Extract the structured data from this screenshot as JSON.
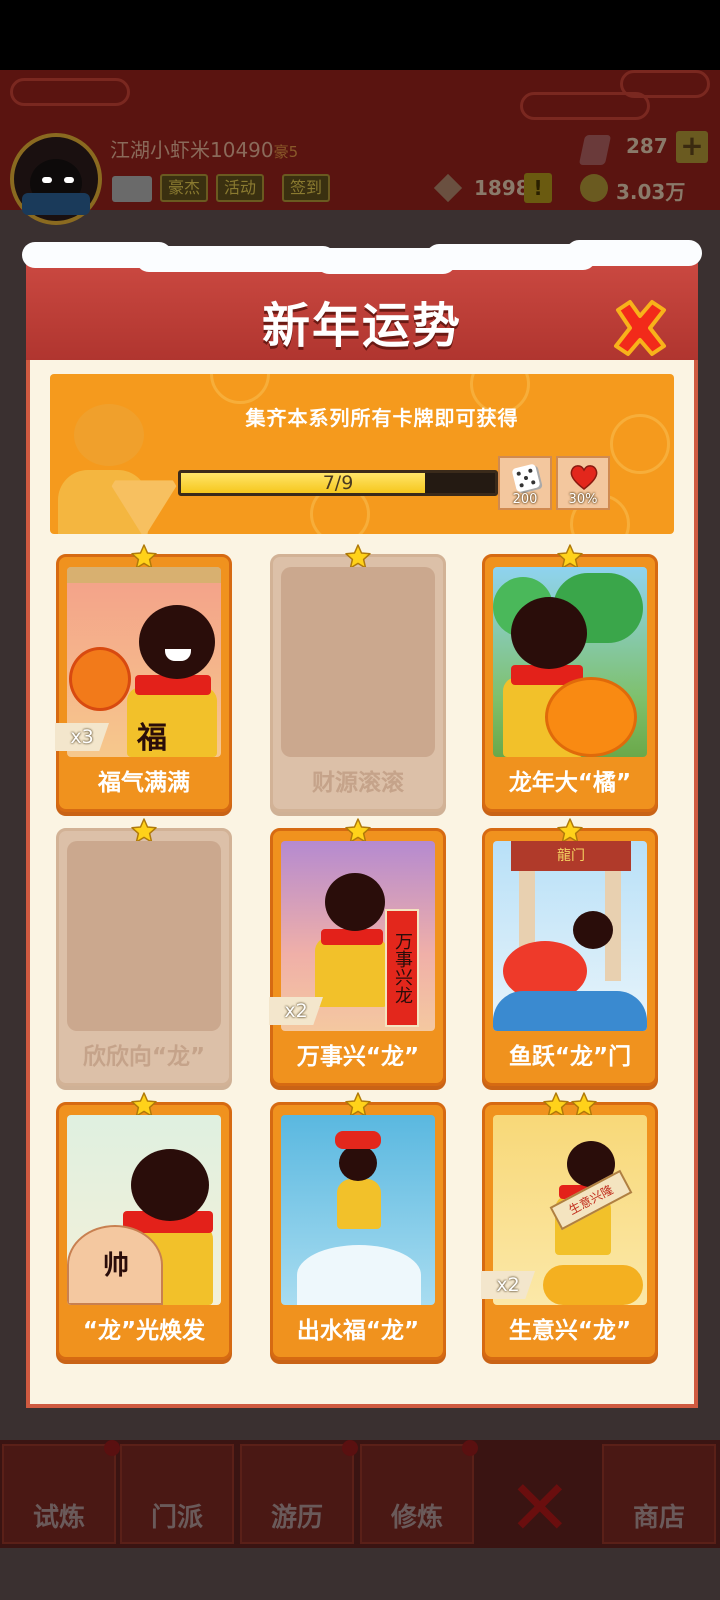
{
  "player": {
    "name": "江湖小虾米10490",
    "vip": "豪5",
    "buttons": [
      "豪杰",
      "活动",
      "签到"
    ],
    "gems": "287",
    "tokens": "1898",
    "coins": "3.03万"
  },
  "dialog": {
    "title": "新年运势",
    "reward_desc": "集齐本系列所有卡牌即可获得",
    "progress": {
      "label": "7/9",
      "collected": 7,
      "total": 9
    },
    "rewards": [
      {
        "icon": "dice-icon",
        "qty": "200"
      },
      {
        "icon": "heart-icon",
        "qty": "30%"
      }
    ],
    "cards": [
      {
        "name": "福气满满",
        "stars": 1,
        "count": "x3",
        "locked": false
      },
      {
        "name": "财源滚滚",
        "stars": 1,
        "count": "",
        "locked": true
      },
      {
        "name": "龙年大“橘”",
        "stars": 1,
        "count": "",
        "locked": false
      },
      {
        "name": "欣欣向“龙”",
        "stars": 1,
        "count": "",
        "locked": true
      },
      {
        "name": "万事兴“龙”",
        "stars": 1,
        "count": "x2",
        "locked": false
      },
      {
        "name": "鱼跃“龙”门",
        "stars": 1,
        "count": "",
        "locked": false
      },
      {
        "name": "“龙”光焕发",
        "stars": 1,
        "count": "",
        "locked": false
      },
      {
        "name": "出水福“龙”",
        "stars": 1,
        "count": "",
        "locked": false
      },
      {
        "name": "生意兴“龙”",
        "stars": 2,
        "count": "x2",
        "locked": false
      }
    ],
    "card_art_text": {
      "fu": "福",
      "scroll": "万事兴龙",
      "gate": "龍门",
      "fan": "帅",
      "sign": "生意兴隆"
    }
  },
  "bottom_nav": {
    "items": [
      {
        "label": "试炼"
      },
      {
        "label": "门派"
      },
      {
        "label": "游历"
      },
      {
        "label": "修炼"
      },
      {
        "label": "商店"
      }
    ]
  },
  "colors": {
    "card_orange": "#f0921e",
    "header_red": "#c0403a",
    "dialog_bg": "#fbf4e3",
    "progress_yellow": "#f6c71c"
  }
}
